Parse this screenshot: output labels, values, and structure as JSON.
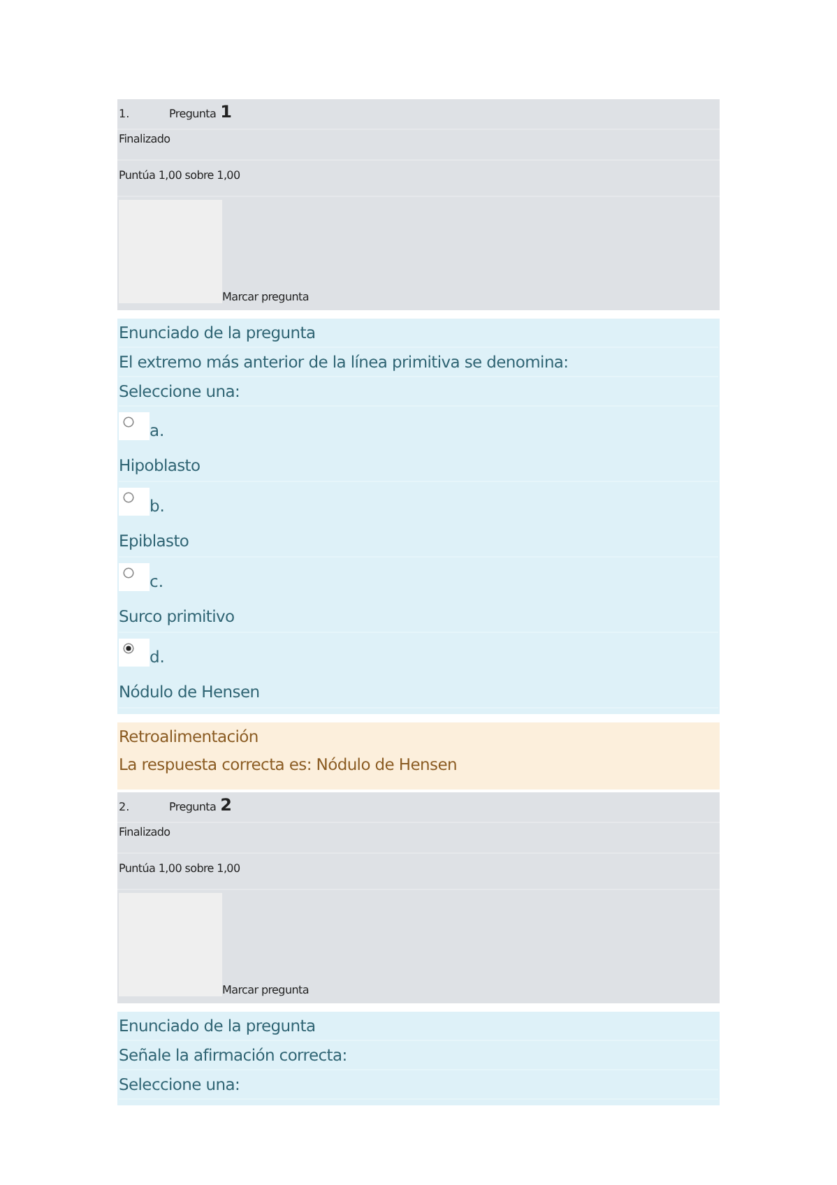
{
  "questions": [
    {
      "number": "1.",
      "label": "Pregunta",
      "index": "1",
      "status": "Finalizado",
      "score": "Puntúa 1,00 sobre 1,00",
      "flag": "Marcar pregunta",
      "heading": "Enunciado de la pregunta",
      "text": "El extremo más anterior de la línea primitiva se denomina:",
      "prompt": "Seleccione una:",
      "options": [
        {
          "letter": "a.",
          "label": "Hipoblasto",
          "selected": false
        },
        {
          "letter": "b.",
          "label": "Epiblasto",
          "selected": false
        },
        {
          "letter": "c.",
          "label": "Surco primitivo",
          "selected": false
        },
        {
          "letter": "d.",
          "label": "Nódulo de Hensen",
          "selected": true
        }
      ],
      "feedback": {
        "heading": "Retroalimentación",
        "text": "La respuesta correcta es: Nódulo de Hensen"
      }
    },
    {
      "number": "2.",
      "label": "Pregunta",
      "index": "2",
      "status": "Finalizado",
      "score": "Puntúa 1,00 sobre 1,00",
      "flag": "Marcar pregunta",
      "heading": "Enunciado de la pregunta",
      "text": "Señale la afirmación correcta:",
      "prompt": "Seleccione una:"
    }
  ]
}
